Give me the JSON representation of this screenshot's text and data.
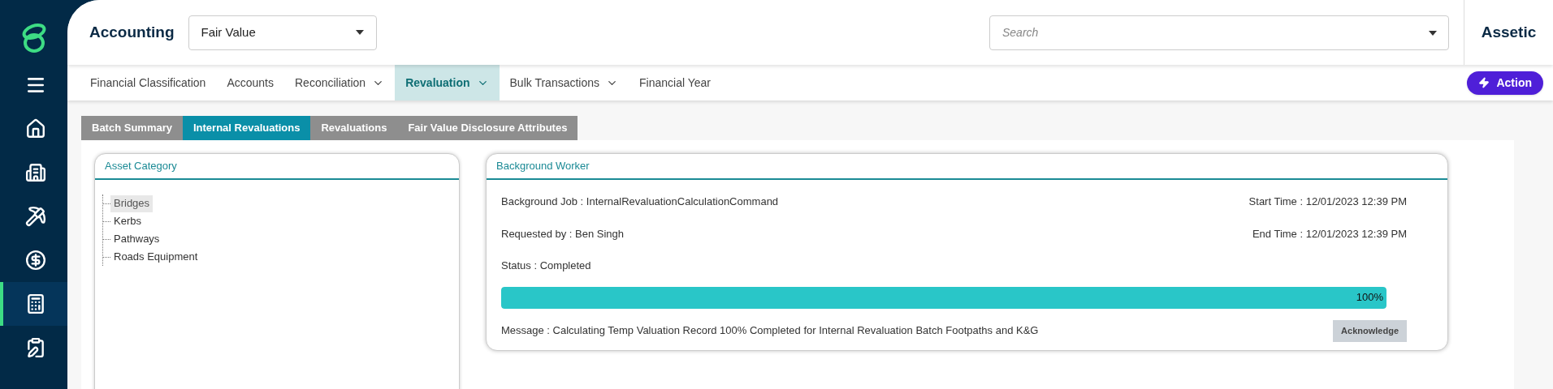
{
  "sidebar": {
    "items": [
      {
        "kind": "menu",
        "selected": false
      },
      {
        "kind": "home",
        "selected": false
      },
      {
        "kind": "buildings",
        "selected": false
      },
      {
        "kind": "worker",
        "selected": false
      },
      {
        "kind": "finance",
        "selected": false
      },
      {
        "kind": "calculator",
        "selected": true
      },
      {
        "kind": "edit",
        "selected": false
      }
    ]
  },
  "header": {
    "title": "Accounting",
    "module_select": {
      "value": "Fair Value"
    },
    "search": {
      "placeholder": "Search"
    },
    "brand": "Assetic"
  },
  "nav": {
    "items": [
      {
        "label": "Financial Classification",
        "dropdown": false,
        "selected": false
      },
      {
        "label": "Accounts",
        "dropdown": false,
        "selected": false
      },
      {
        "label": "Reconciliation",
        "dropdown": true,
        "selected": false
      },
      {
        "label": "Revaluation",
        "dropdown": true,
        "selected": true
      },
      {
        "label": "Bulk Transactions",
        "dropdown": true,
        "selected": false
      },
      {
        "label": "Financial Year",
        "dropdown": false,
        "selected": false
      }
    ],
    "action": "Action"
  },
  "tabs": [
    {
      "label": "Batch Summary",
      "selected": false
    },
    {
      "label": "Internal Revaluations",
      "selected": true
    },
    {
      "label": "Revaluations",
      "selected": false
    },
    {
      "label": "Fair Value Disclosure Attributes",
      "selected": false
    }
  ],
  "asset_category": {
    "title": "Asset Category",
    "items": [
      {
        "label": "Bridges",
        "selected": true
      },
      {
        "label": "Kerbs",
        "selected": false
      },
      {
        "label": "Pathways",
        "selected": false
      },
      {
        "label": "Roads Equipment",
        "selected": false
      }
    ]
  },
  "background_worker": {
    "title": "Background Worker",
    "job": "Background Job : InternalRevaluationCalculationCommand",
    "start_time": "Start Time : 12/01/2023 12:39 PM",
    "requested_by": "Requested by : Ben Singh",
    "end_time": "End Time : 12/01/2023 12:39 PM",
    "status": "Status : Completed",
    "progress": {
      "level": 1,
      "reading": "100%"
    },
    "message": "Message : Calculating Temp Valuation Record 100% Completed for Internal Revaluation Batch Footpaths and K&G",
    "acknowledge": "Acknowledge"
  }
}
